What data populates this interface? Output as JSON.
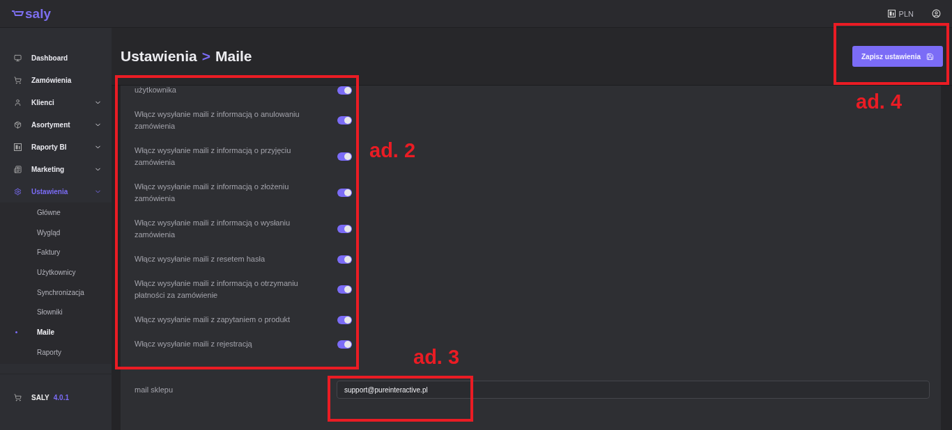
{
  "topbar": {
    "logo": "saly",
    "currency": "PLN"
  },
  "sidebar": {
    "items": [
      {
        "label": "Dashboard",
        "kind": "link",
        "selected": false
      },
      {
        "label": "Zamówienia",
        "kind": "link",
        "selected": false
      },
      {
        "label": "Klienci",
        "kind": "group",
        "selected": false
      },
      {
        "label": "Asortyment",
        "kind": "group",
        "selected": false
      },
      {
        "label": "Raporty BI",
        "kind": "group",
        "selected": false
      },
      {
        "label": "Marketing",
        "kind": "group",
        "selected": false
      },
      {
        "label": "Ustawienia",
        "kind": "group",
        "selected": true,
        "children": [
          {
            "label": "Główne",
            "selected": false
          },
          {
            "label": "Wygląd",
            "selected": false
          },
          {
            "label": "Faktury",
            "selected": false
          },
          {
            "label": "Użytkownicy",
            "selected": false
          },
          {
            "label": "Synchronizacja",
            "selected": false
          },
          {
            "label": "Słowniki",
            "selected": false
          },
          {
            "label": "Maile",
            "selected": true
          },
          {
            "label": "Raporty",
            "selected": false
          }
        ]
      }
    ],
    "footer": {
      "name": "SALY",
      "version": "4.0.1"
    }
  },
  "page": {
    "breadcrumb": [
      "Ustawienia",
      "Maile"
    ],
    "separator": ">",
    "save_button": "Zapisz ustawienia"
  },
  "settings": [
    {
      "label": "użytkownika",
      "on": true
    },
    {
      "label": "Włącz wysyłanie maili z informacją o anulowaniu zamówienia",
      "on": true
    },
    {
      "label": "Włącz wysyłanie maili z informacją o przyjęciu zamówienia",
      "on": true
    },
    {
      "label": "Włącz wysyłanie maili z informacją o złożeniu zamówienia",
      "on": true
    },
    {
      "label": "Włącz wysyłanie maili z informacją o wysłaniu zamówienia",
      "on": true
    },
    {
      "label": "Włącz wysyłanie maili z resetem hasła",
      "on": true
    },
    {
      "label": "Włącz wysyłanie maili z informacją o otrzymaniu płatności za zamówienie",
      "on": true
    },
    {
      "label": "Włącz wysyłanie maili z zapytaniem o produkt",
      "on": true
    },
    {
      "label": "Włącz wysyłanie maili z rejestracją",
      "on": true
    }
  ],
  "shop_mail": {
    "label": "mail sklepu",
    "value": "support@pureinteractive.pl"
  },
  "annotations": [
    {
      "label": "ad. 2"
    },
    {
      "label": "ad. 3"
    },
    {
      "label": "ad. 4"
    }
  ]
}
